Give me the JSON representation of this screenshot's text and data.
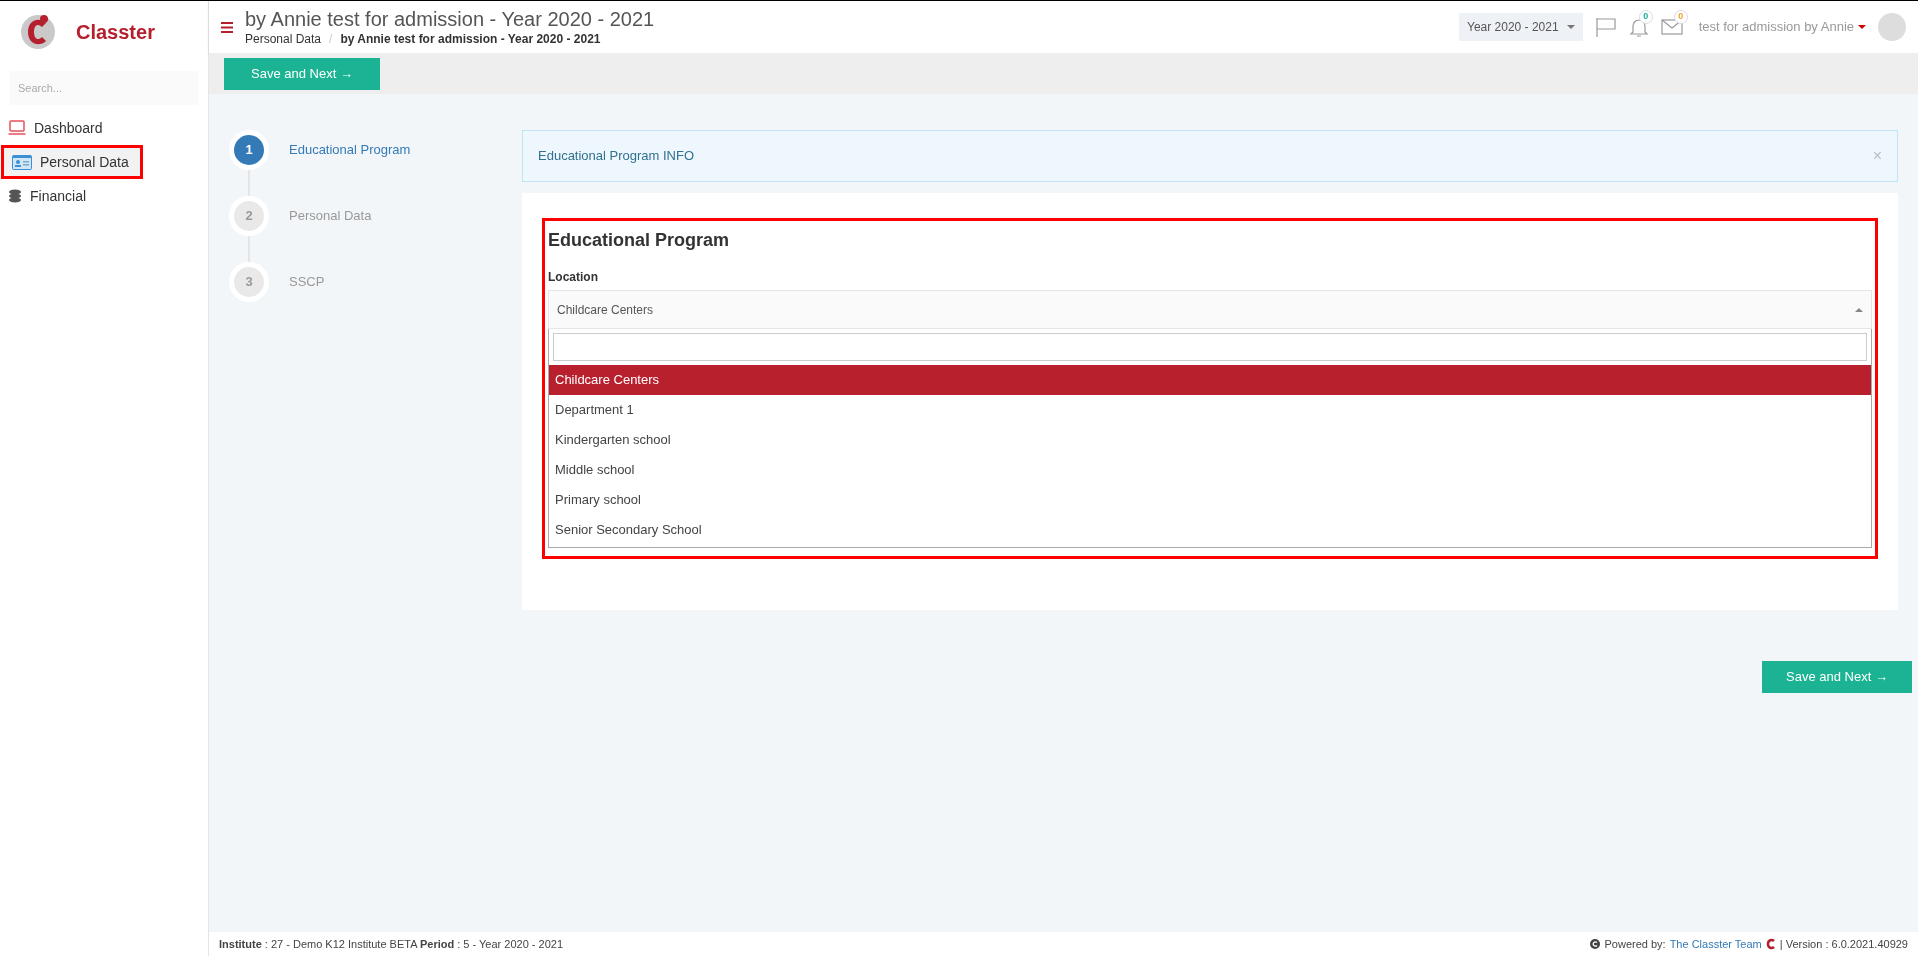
{
  "brand": {
    "name": "Classter"
  },
  "sidebar": {
    "search": {
      "placeholder": "Search..."
    },
    "items": [
      {
        "label": "Dashboard",
        "kind": "laptop",
        "selected": false,
        "annotated": false
      },
      {
        "label": "Personal Data",
        "kind": "card",
        "selected": true,
        "annotated": true
      },
      {
        "label": "Financial",
        "kind": "coins",
        "selected": false,
        "annotated": false
      }
    ]
  },
  "header": {
    "title": "by Annie test for admission - Year 2020 - 2021",
    "breadcrumb": [
      "Personal Data",
      "by Annie test for admission - Year 2020 - 2021"
    ],
    "breadcrumb_separator": "/",
    "year_select": "Year 2020 - 2021",
    "notifications": "0",
    "messages": "0",
    "user": "test for admission by Annie"
  },
  "toolbar": {
    "button": "Save and Next →"
  },
  "steps": [
    {
      "number": "1",
      "label": "Educational Program",
      "selected": true
    },
    {
      "number": "2",
      "label": "Personal Data",
      "selected": false
    },
    {
      "number": "3",
      "label": "SSCP",
      "selected": false
    }
  ],
  "info": {
    "text": "Educational Program INFO",
    "close": "×"
  },
  "form": {
    "title": "Educational Program",
    "annotated": true,
    "field_label": "Location",
    "value": "Childcare Centers",
    "expanded": true,
    "options": [
      {
        "label": "Childcare Centers",
        "selected": true
      },
      {
        "label": "Department 1",
        "selected": false
      },
      {
        "label": "Kindergarten school",
        "selected": false
      },
      {
        "label": "Middle school",
        "selected": false
      },
      {
        "label": "Primary school",
        "selected": false
      },
      {
        "label": "Senior Secondary School",
        "selected": false
      }
    ]
  },
  "bottom_button": "Save and Next →",
  "footer": {
    "info": "**Institute** : 27 - Demo K12 Institute BETA **Period** : 5 - Year 2020 - 2021",
    "powered_label": "Powered by:",
    "powered_link": "The Classter Team",
    "version": "| Version : 6.0.2021.40929"
  }
}
